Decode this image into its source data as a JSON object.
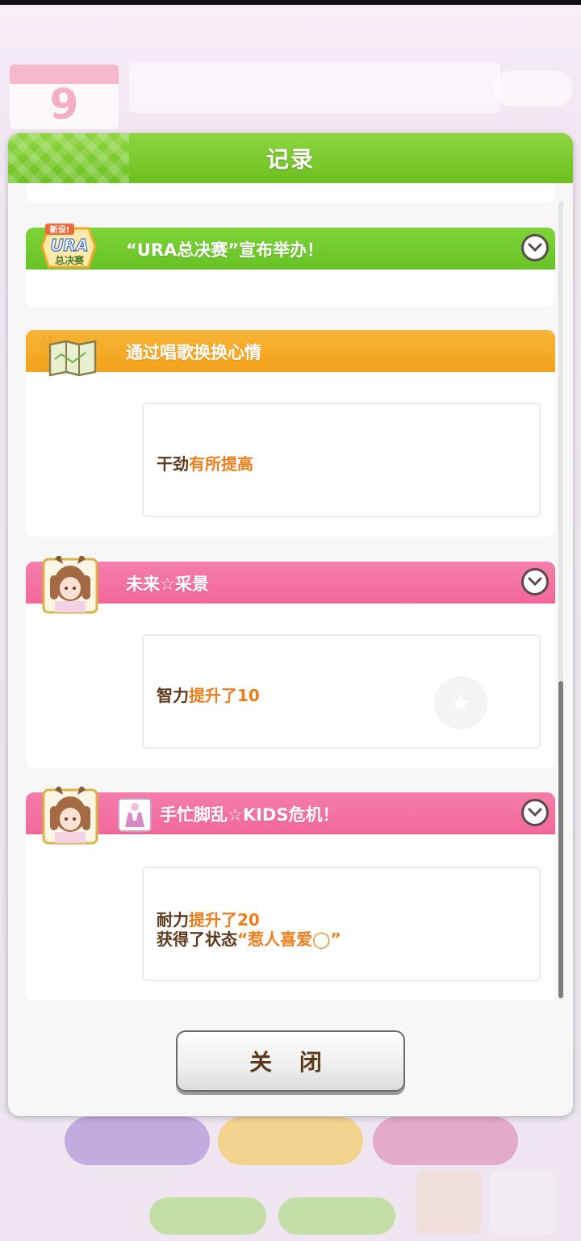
{
  "background": {
    "date_number": "9"
  },
  "dialog": {
    "title": "记录",
    "close_label": "关 闭"
  },
  "entries": [
    {
      "title": "“URA总决赛”宣布举办！",
      "badge_top": "新设!",
      "badge_main": "URA",
      "badge_bottom": "总决赛",
      "color": "#6cc224"
    },
    {
      "title": "通过唱歌换换心情",
      "color": "#f3a21c",
      "result": [
        {
          "prefix": "干劲",
          "highlight": "有所提高"
        }
      ]
    },
    {
      "title": "未来☆采景",
      "color": "#f2679a",
      "result": [
        {
          "prefix": "智力",
          "highlight": "提升了10"
        }
      ]
    },
    {
      "title": "手忙脚乱☆KIDS危机！",
      "color": "#f2679a",
      "result": [
        {
          "prefix": "耐力",
          "highlight": "提升了20"
        },
        {
          "prefix": "获得了状态",
          "highlight": "“惹人喜爱◯”"
        }
      ]
    }
  ],
  "icons": {
    "expand": "chevron-down-icon",
    "map": "map-icon",
    "portrait": "character-portrait-icon",
    "costume": "outfit-card-icon"
  }
}
